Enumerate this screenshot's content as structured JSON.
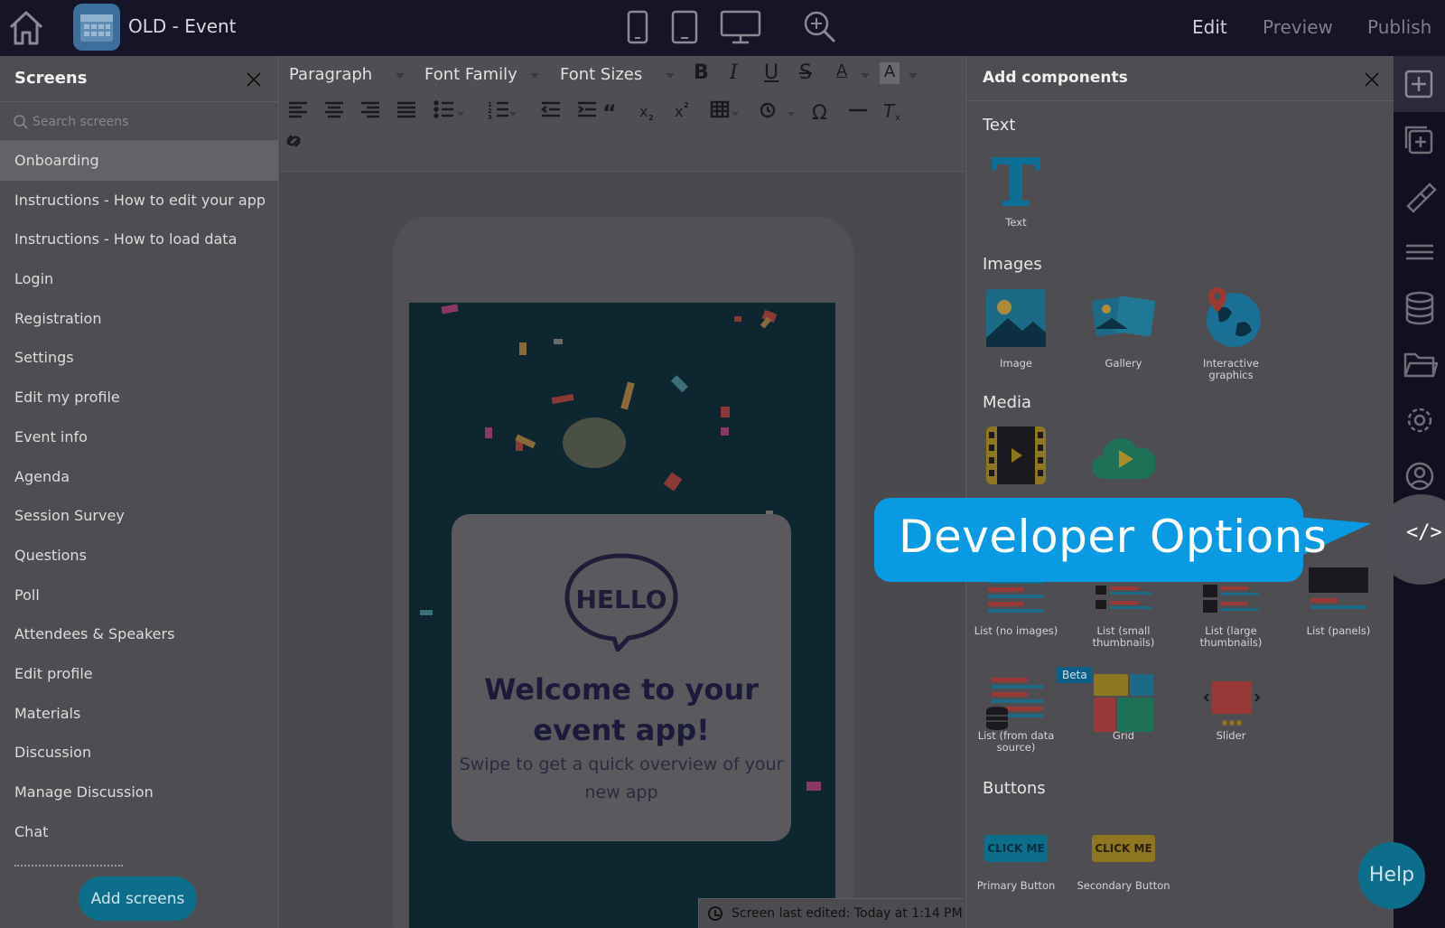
{
  "topbar": {
    "app_title": "OLD - Event",
    "nav": {
      "edit": "Edit",
      "preview": "Preview",
      "publish": "Publish"
    }
  },
  "screens_panel": {
    "title": "Screens",
    "search_placeholder": "Search screens",
    "items": [
      "Onboarding",
      "Instructions - How to edit your app",
      "Instructions - How to load data",
      "Login",
      "Registration",
      "Settings",
      "Edit my profile",
      "Event info",
      "Agenda",
      "Session Survey",
      "Questions",
      "Poll",
      "Attendees & Speakers",
      "Edit profile",
      "Materials",
      "Discussion",
      "Manage Discussion",
      "Chat"
    ],
    "add_button": "Add screens"
  },
  "toolbar": {
    "paragraph": "Paragraph",
    "font_family": "Font Family",
    "font_sizes": "Font Sizes"
  },
  "canvas": {
    "hello": "HELLO",
    "welcome_title": "Welcome to your event app!",
    "welcome_subtitle": "Swipe to get a quick overview of your new app",
    "last_edited": "Screen last edited: Today at 1:14 PM"
  },
  "components_panel": {
    "title": "Add components",
    "sections": {
      "text": "Text",
      "images": "Images",
      "media": "Media",
      "buttons": "Buttons"
    },
    "text_items": [
      "Text"
    ],
    "image_items": [
      "Image",
      "Gallery",
      "Interactive graphics"
    ],
    "list_items": [
      "List (no images)",
      "List (small thumbnails)",
      "List (large thumbnails)",
      "List (panels)"
    ],
    "list_items_2": [
      "List (from data source)",
      "Grid",
      "Slider"
    ],
    "beta_badge": "Beta",
    "button_items": [
      {
        "preview": "CLICK ME",
        "label": "Primary Button"
      },
      {
        "preview": "CLICK ME",
        "label": "Secondary Button"
      }
    ]
  },
  "callout": {
    "text": "Developer Options"
  },
  "help": "Help",
  "colors": {
    "accent": "#0a9ae4",
    "topbar": "#161427",
    "rail": "#111021",
    "teal_button": "#0d6e8c"
  }
}
